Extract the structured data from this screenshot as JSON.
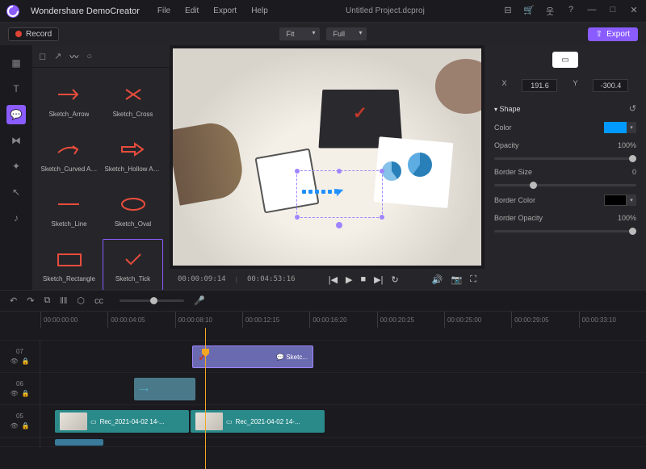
{
  "app": {
    "name": "Wondershare DemoCreator",
    "project": "Untitled Project.dcproj"
  },
  "menu": {
    "file": "File",
    "edit": "Edit",
    "export": "Export",
    "help": "Help"
  },
  "toolbar": {
    "record": "Record",
    "fit": "Fit",
    "full": "Full",
    "export": "Export"
  },
  "shapes": {
    "items": [
      {
        "label": "Sketch_Arrow"
      },
      {
        "label": "Sketch_Cross"
      },
      {
        "label": "Sketch_Curved Arr..."
      },
      {
        "label": "Sketch_Hollow Arr..."
      },
      {
        "label": "Sketch_Line"
      },
      {
        "label": "Sketch_Oval"
      },
      {
        "label": "Sketch_Rectangle"
      },
      {
        "label": "Sketch_Tick"
      }
    ]
  },
  "player": {
    "current": "00:00:09:14",
    "total": "00:04:53:16"
  },
  "props": {
    "x": "191.6",
    "y": "-300.4",
    "section": "Shape",
    "color_label": "Color",
    "color": "#0099ff",
    "opacity_label": "Opacity",
    "opacity": "100%",
    "bsize_label": "Border Size",
    "bsize": "0",
    "bcolor_label": "Border Color",
    "bopacity_label": "Border Opacity",
    "bopacity": "100%"
  },
  "ruler": [
    "00:00:00:00",
    "00:00:04:05",
    "00:00:08:10",
    "00:00:12:15",
    "00:00:16:20",
    "00:00:20:25",
    "00:00:25:00",
    "00:00:29:05",
    "00:00:33:10"
  ],
  "tracks": {
    "t07": "07",
    "t06": "06",
    "t05": "05",
    "clip_sketch": "Sketc...",
    "clip_rec": "Rec_2021-04-02 14-..."
  }
}
